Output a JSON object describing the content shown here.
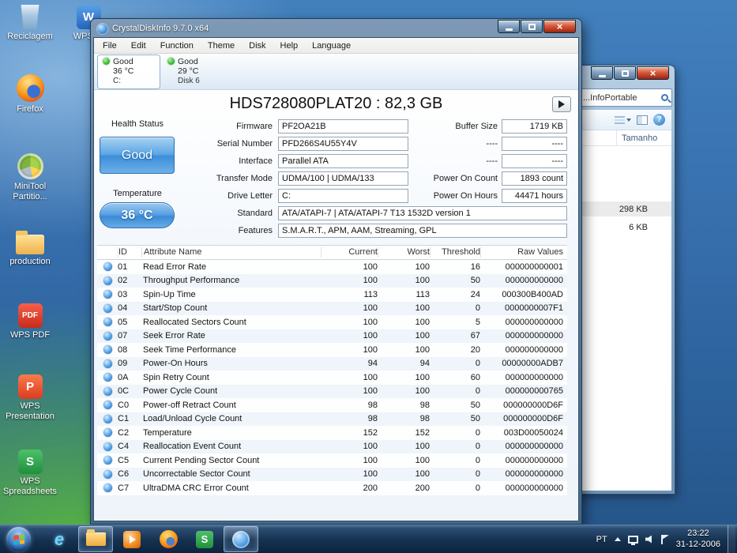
{
  "desktop": {
    "icons": [
      {
        "name": "recycle-bin",
        "label": "Reciclagem",
        "glyph": ""
      },
      {
        "name": "firefox",
        "label": "Firefox",
        "glyph": ""
      },
      {
        "name": "minitool",
        "label": "MiniTool Partitio...",
        "glyph": ""
      },
      {
        "name": "production-folder",
        "label": "production",
        "glyph": ""
      },
      {
        "name": "wps-pdf",
        "label": "WPS PDF",
        "glyph": "PDF"
      },
      {
        "name": "wps-presentation",
        "label": "WPS Presentation",
        "glyph": "P"
      },
      {
        "name": "wps-spreadsheets",
        "label": "WPS Spreadsheets",
        "glyph": "S"
      }
    ],
    "icon2": {
      "name": "wps-writer",
      "label": "WPS W",
      "glyph": "W"
    }
  },
  "app": {
    "title": "CrystalDiskInfo 9.7.0 x64",
    "menu": [
      "File",
      "Edit",
      "Function",
      "Theme",
      "Disk",
      "Help",
      "Language"
    ],
    "disks": [
      {
        "status": "Good",
        "temp": "36 °C",
        "name": "C:"
      },
      {
        "status": "Good",
        "temp": "29 °C",
        "name": "Disk 6"
      }
    ],
    "model": "HDS728080PLAT20 : 82,3 GB",
    "health": {
      "label": "Health Status",
      "value": "Good"
    },
    "temperature": {
      "label": "Temperature",
      "value": "36 °C"
    },
    "fields_left": [
      {
        "label": "Firmware",
        "value": "PF2OA21B"
      },
      {
        "label": "Serial Number",
        "value": "PFD266S4U55Y4V"
      },
      {
        "label": "Interface",
        "value": "Parallel ATA"
      },
      {
        "label": "Transfer Mode",
        "value": "UDMA/100 | UDMA/133"
      },
      {
        "label": "Drive Letter",
        "value": "C:"
      },
      {
        "label": "Standard",
        "value": "ATA/ATAPI-7 | ATA/ATAPI-7 T13 1532D version 1"
      },
      {
        "label": "Features",
        "value": "S.M.A.R.T., APM, AAM, Streaming, GPL"
      }
    ],
    "fields_right": [
      {
        "label": "Buffer Size",
        "value": "1719 KB"
      },
      {
        "label": "----",
        "value": "----"
      },
      {
        "label": "----",
        "value": "----"
      },
      {
        "label": "Power On Count",
        "value": "1893 count"
      },
      {
        "label": "Power On Hours",
        "value": "44471 hours"
      }
    ],
    "table": {
      "headers": [
        "ID",
        "Attribute Name",
        "Current",
        "Worst",
        "Threshold",
        "Raw Values"
      ],
      "rows": [
        [
          "01",
          "Read Error Rate",
          "100",
          "100",
          "16",
          "000000000001"
        ],
        [
          "02",
          "Throughput Performance",
          "100",
          "100",
          "50",
          "000000000000"
        ],
        [
          "03",
          "Spin-Up Time",
          "113",
          "113",
          "24",
          "000300B400AD"
        ],
        [
          "04",
          "Start/Stop Count",
          "100",
          "100",
          "0",
          "0000000007F1"
        ],
        [
          "05",
          "Reallocated Sectors Count",
          "100",
          "100",
          "5",
          "000000000000"
        ],
        [
          "07",
          "Seek Error Rate",
          "100",
          "100",
          "67",
          "000000000000"
        ],
        [
          "08",
          "Seek Time Performance",
          "100",
          "100",
          "20",
          "000000000000"
        ],
        [
          "09",
          "Power-On Hours",
          "94",
          "94",
          "0",
          "00000000ADB7"
        ],
        [
          "0A",
          "Spin Retry Count",
          "100",
          "100",
          "60",
          "000000000000"
        ],
        [
          "0C",
          "Power Cycle Count",
          "100",
          "100",
          "0",
          "000000000765"
        ],
        [
          "C0",
          "Power-off Retract Count",
          "98",
          "98",
          "50",
          "000000000D6F"
        ],
        [
          "C1",
          "Load/Unload Cycle Count",
          "98",
          "98",
          "50",
          "000000000D6F"
        ],
        [
          "C2",
          "Temperature",
          "152",
          "152",
          "0",
          "003D00050024"
        ],
        [
          "C4",
          "Reallocation Event Count",
          "100",
          "100",
          "0",
          "000000000000"
        ],
        [
          "C5",
          "Current Pending Sector Count",
          "100",
          "100",
          "0",
          "000000000000"
        ],
        [
          "C6",
          "Uncorrectable Sector Count",
          "100",
          "100",
          "0",
          "000000000000"
        ],
        [
          "C7",
          "UltraDMA CRC Error Count",
          "200",
          "200",
          "0",
          "000000000000"
        ]
      ]
    }
  },
  "explorer": {
    "search_text": "...InfoPortable",
    "column_header": "Tamanho",
    "files": [
      {
        "size": "298 KB"
      },
      {
        "size": "6 KB"
      }
    ]
  },
  "taskbar": {
    "apps": [
      {
        "name": "internet-explorer",
        "glyph": "e",
        "active": false
      },
      {
        "name": "windows-explorer",
        "glyph": "",
        "active": true
      },
      {
        "name": "media-player",
        "glyph": "",
        "active": false
      },
      {
        "name": "firefox",
        "glyph": "",
        "active": false
      },
      {
        "name": "wps-spreadsheets",
        "glyph": "S",
        "active": false
      },
      {
        "name": "crystaldiskinfo",
        "glyph": "",
        "active": true
      }
    ],
    "language": "PT",
    "time": "23:22",
    "date": "31-12-2006"
  }
}
